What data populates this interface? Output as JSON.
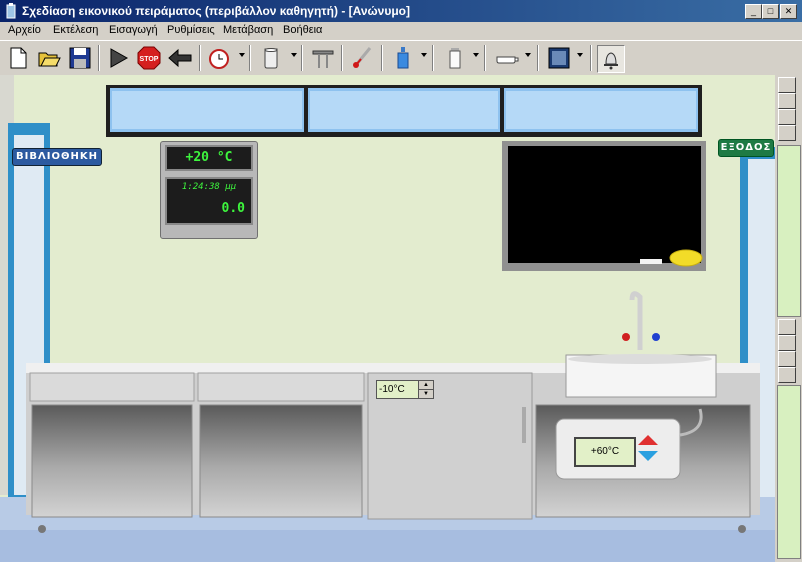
{
  "window": {
    "title": "Σχεδίαση εικονικού πειράματος (περιβάλλον καθηγητή) - [Ανώνυμο]"
  },
  "menu": [
    "Αρχείο",
    "Εκτέλεση",
    "Εισαγωγή",
    "Ρυθμίσεις",
    "Μετάβαση",
    "Βοήθεια"
  ],
  "toolbar": {
    "icons": [
      "new-file-icon",
      "open-folder-icon",
      "save-disk-icon",
      "play-icon",
      "stop-sign-icon",
      "back-arrow-icon",
      "alarm-clock-icon",
      "beaker-icon",
      "stand-icon",
      "thermometer-icon",
      "bottle-icon",
      "jar-icon",
      "dish-icon",
      "picture-icon",
      "bell-icon"
    ],
    "stop_text": "STOP"
  },
  "lab": {
    "library_label": "ΒΙΒΛΙΟΘΗΚΗ",
    "exit_label": "ΕΞΟΔΟΣ",
    "room_temperature": "+20 °C",
    "clock_time": "1:24:38 μμ",
    "timer_value": "0.0",
    "fridge_temperature": "-10°C",
    "heater_temperature": "+60°C"
  },
  "colors": {
    "title_start": "#0a246a",
    "wall": "#e3eccf",
    "lcd_text": "#3df53d",
    "sign_blue": "#2c5aa0",
    "sign_green": "#1e7a44"
  }
}
